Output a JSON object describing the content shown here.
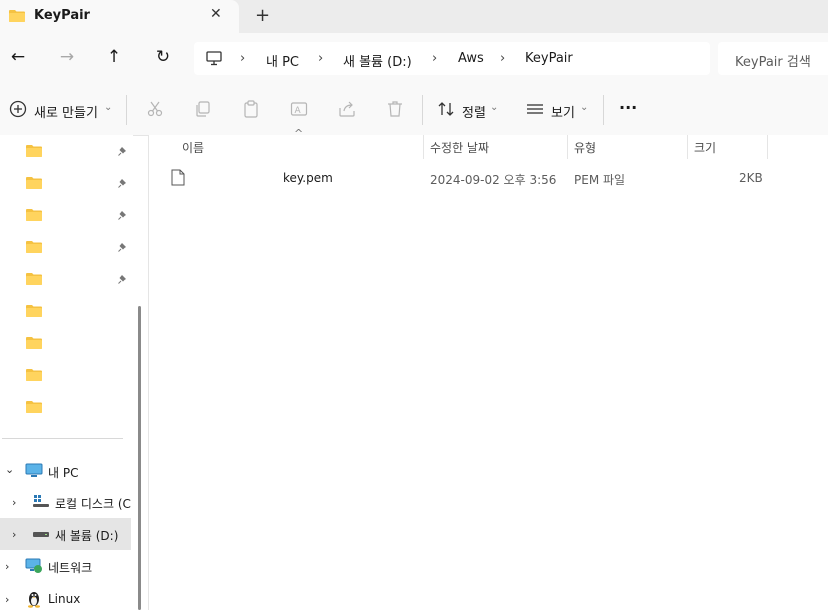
{
  "window": {
    "tab_title": "KeyPair",
    "tab_close": "✕",
    "new_tab": "+"
  },
  "nav": {
    "back": "←",
    "forward": "→",
    "up": "↑",
    "refresh": "↻"
  },
  "breadcrumb": [
    "내 PC",
    "새 볼륨 (D:)",
    "Aws",
    "KeyPair"
  ],
  "search": {
    "placeholder": "KeyPair 검색"
  },
  "toolbar": {
    "new_label": "새로 만들기",
    "sort_label": "정렬",
    "view_label": "보기",
    "more_label": "···",
    "icons": [
      "cut-icon",
      "copy-icon",
      "paste-icon",
      "rename-icon",
      "share-icon",
      "delete-icon"
    ]
  },
  "sidebar": {
    "quick_access_count": 9,
    "tree": [
      {
        "label": "내 PC",
        "expanded": true,
        "icon": "pc-icon"
      },
      {
        "label": "로컬 디스크 (C",
        "icon": "windows-drive-icon"
      },
      {
        "label": "새 볼륨 (D:)",
        "icon": "drive-icon",
        "selected": true
      },
      {
        "label": "네트워크",
        "icon": "network-icon"
      },
      {
        "label": "Linux",
        "icon": "linux-icon"
      }
    ]
  },
  "columns": {
    "sort_indicator": "^",
    "name": "이름",
    "modified": "수정한 날짜",
    "type": "유형",
    "size": "크기"
  },
  "files": [
    {
      "name": "key.pem",
      "modified": "2024-09-02 오후 3:56",
      "type": "PEM 파일",
      "size": "2KB"
    }
  ],
  "colors": {
    "folder_yellow": "#f5c242",
    "selected_bg": "#e5e5e5",
    "chrome_bg": "#f9f9f9",
    "tabbar_bg": "#ececec"
  }
}
